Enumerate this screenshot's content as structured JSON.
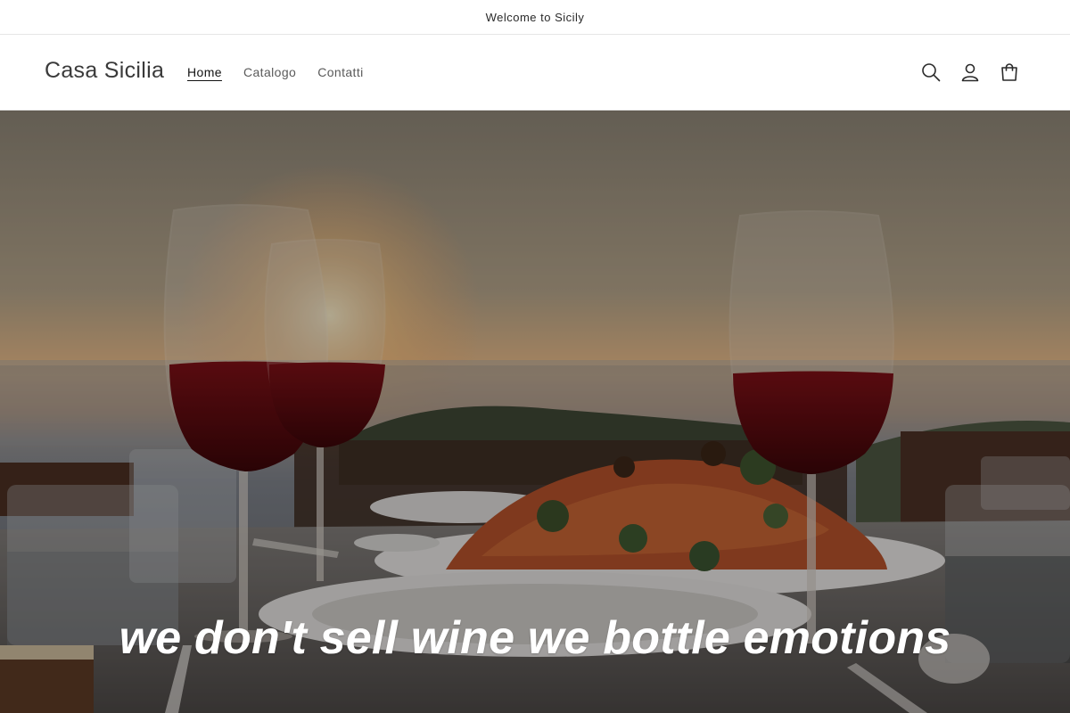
{
  "announcement": {
    "text": "Welcome to Sicily"
  },
  "header": {
    "logo": "Casa Sicilia",
    "nav": [
      {
        "label": "Home",
        "active": true
      },
      {
        "label": "Catalogo",
        "active": false
      },
      {
        "label": "Contatti",
        "active": false
      }
    ],
    "icons": [
      "search-icon",
      "account-icon",
      "cart-icon"
    ]
  },
  "hero": {
    "heading": "we don't sell wine we bottle emotions",
    "image": "sunset-dinner-table-wine-glasses-pasta"
  },
  "colors": {
    "text": "#121212",
    "nav_muted": "#5a5a5a",
    "border": "#e6e6e6",
    "wine": "#6b0f14",
    "sunset": "#f2b46a"
  }
}
